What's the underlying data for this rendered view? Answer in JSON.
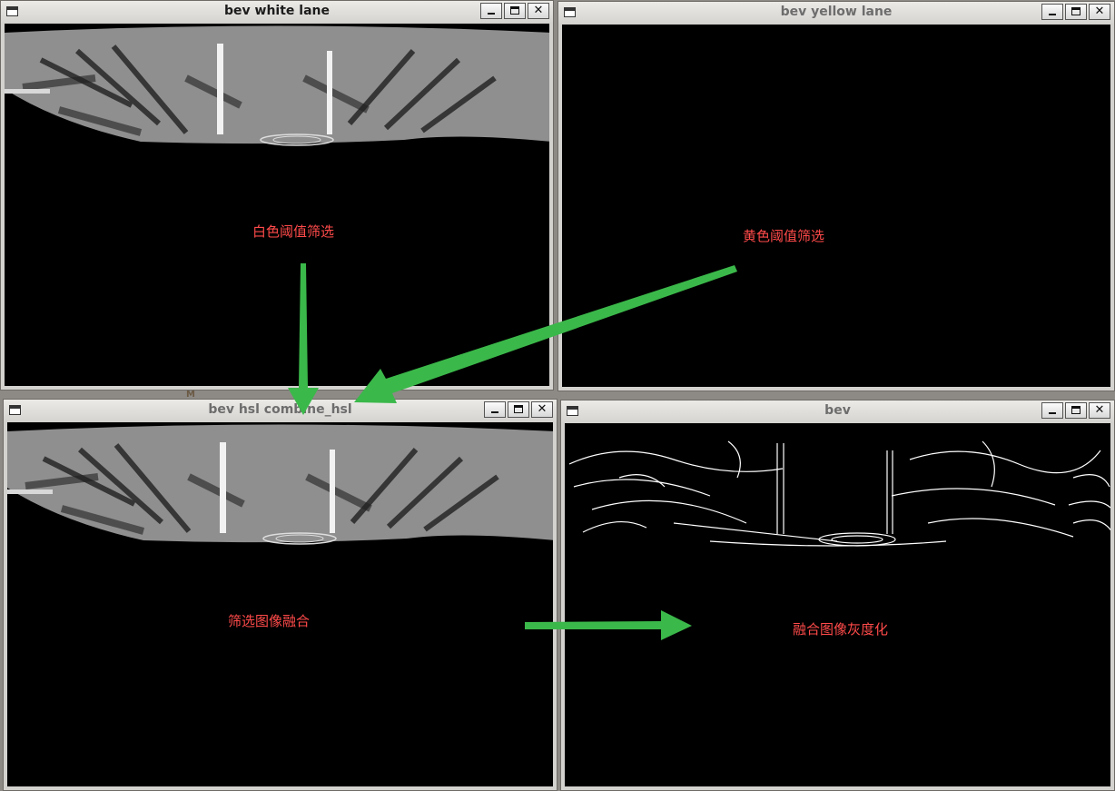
{
  "windows": [
    {
      "title": "bev white lane",
      "caption": "白色阈值筛选"
    },
    {
      "title": "bev yellow lane",
      "caption": "黄色阈值筛选"
    },
    {
      "title": "bev hsl combine_hsl",
      "caption": "筛选图像融合"
    },
    {
      "title": "bev",
      "caption": "融合图像灰度化"
    }
  ],
  "buttons": {
    "minimize": "_",
    "maximize": "□",
    "close": "✕"
  },
  "stray_glyph": "M",
  "colors": {
    "arrow": "#3bb84a",
    "caption": "#ff4a4a",
    "canvas": "#000000"
  }
}
